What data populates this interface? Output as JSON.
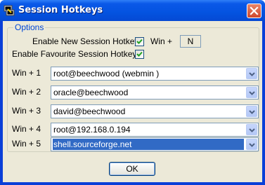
{
  "window": {
    "title": "Session Hotkeys",
    "app_icon": "putty-icon",
    "close_icon": "close-icon"
  },
  "options": {
    "group_title": "Options",
    "enable_new_session_label": "Enable New Session Hotkey",
    "enable_new_session_checked": true,
    "win_plus_label": "Win +",
    "new_session_key": "N",
    "enable_favourite_label": "Enable Favourite Session Hotkeys",
    "enable_favourite_checked": true
  },
  "hotkeys": [
    {
      "label": "Win + 1",
      "value": "root@beechwood (webmin )",
      "selected": false
    },
    {
      "label": "Win + 2",
      "value": "oracle@beechwood",
      "selected": false
    },
    {
      "label": "Win + 3",
      "value": "david@beechwood",
      "selected": false
    },
    {
      "label": "Win + 4",
      "value": "root@192.168.0.194",
      "selected": false
    },
    {
      "label": "Win + 5",
      "value": "shell.sourceforge.net",
      "selected": true
    }
  ],
  "ok_label": "OK",
  "colors": {
    "title_bar": "#0453e0",
    "client_bg": "#ece9d8",
    "group_title": "#0046d5",
    "selection": "#316ac5"
  }
}
